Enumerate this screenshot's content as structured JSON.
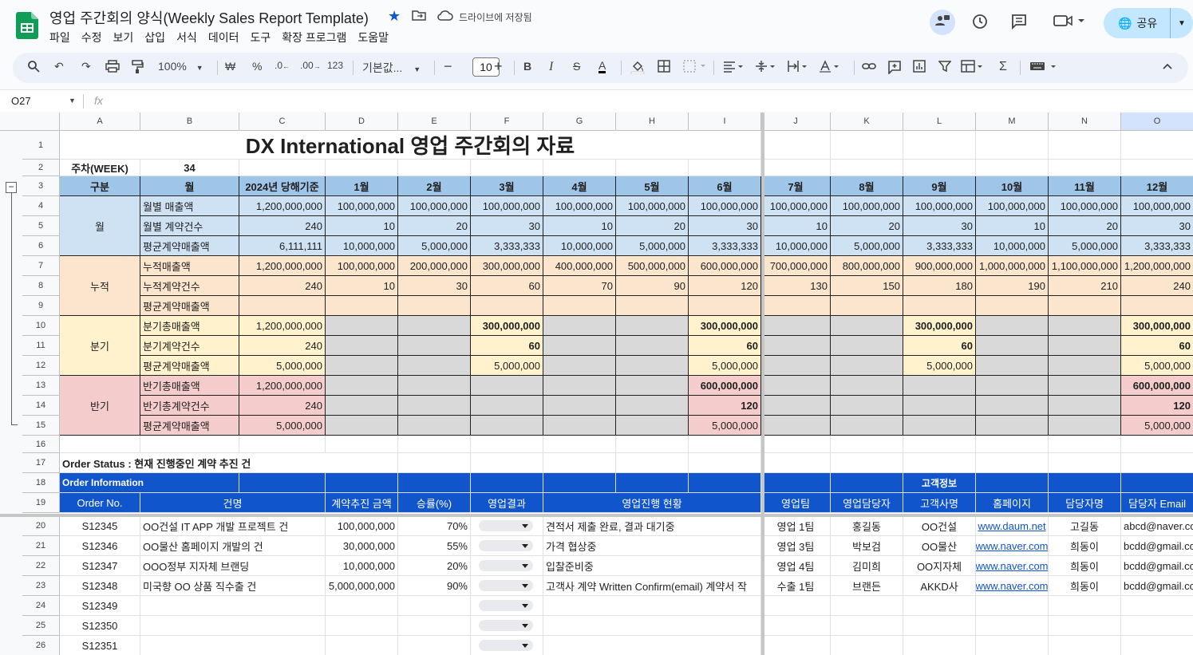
{
  "doc": {
    "title": "영업 주간회의 양식(Weekly Sales Report Template)",
    "saved": "드라이브에 저장됨",
    "share": "공유"
  },
  "menu": [
    "파일",
    "수정",
    "보기",
    "삽입",
    "서식",
    "데이터",
    "도구",
    "확장 프로그램",
    "도움말"
  ],
  "toolbar": {
    "zoom": "100%",
    "currency": "₩",
    "percent": "%",
    "dec_less": ".0",
    "dec_more": ".00",
    "num_fmt": "123",
    "font": "기본값...",
    "font_size": "10"
  },
  "formula": {
    "cell_ref": "O27",
    "fx": "fx"
  },
  "columns": [
    "A",
    "B",
    "C",
    "D",
    "E",
    "F",
    "G",
    "H",
    "I",
    "J",
    "K",
    "L",
    "M",
    "N",
    "O"
  ],
  "rows": [
    "1",
    "2",
    "3",
    "4",
    "5",
    "6",
    "7",
    "8",
    "9",
    "10",
    "11",
    "12",
    "13",
    "14",
    "15",
    "16",
    "17",
    "18",
    "19",
    "20",
    "21",
    "22",
    "23",
    "24",
    "25",
    "26"
  ],
  "sheet": {
    "title": "DX International 영업 주간회의 자료",
    "week_label": "주차(WEEK)",
    "week_value": "34",
    "header": {
      "group": "구분",
      "sub": "월",
      "total": "2024년 당해기준",
      "months": [
        "1월",
        "2월",
        "3월",
        "4월",
        "5월",
        "6월",
        "7월",
        "8월",
        "9월",
        "10월",
        "11월",
        "12월"
      ]
    },
    "groups": [
      "월",
      "누적",
      "분기",
      "반기"
    ],
    "labels": [
      "월별 매출액",
      "월별 계약건수",
      "평균계약매출액",
      "누적매출액",
      "누적계약건수",
      "평균계약매출액",
      "분기총매출액",
      "분기계약건수",
      "평균계약매출액",
      "반기총매출액",
      "반기총계약건수",
      "평균계약매출액"
    ],
    "totals": [
      "1,200,000,000",
      "240",
      "6,111,111",
      "1,200,000,000",
      "240",
      "",
      "1,200,000,000",
      "240",
      "5,000,000",
      "1,200,000,000",
      "240",
      "5,000,000"
    ],
    "monthly_sales": [
      "100,000,000",
      "100,000,000",
      "100,000,000",
      "100,000,000",
      "100,000,000",
      "100,000,000",
      "100,000,000",
      "100,000,000",
      "100,000,000",
      "100,000,000",
      "100,000,000",
      "100,000,000"
    ],
    "monthly_count": [
      "10",
      "20",
      "30",
      "10",
      "20",
      "30",
      "10",
      "20",
      "30",
      "10",
      "20",
      "30"
    ],
    "monthly_avg": [
      "10,000,000",
      "5,000,000",
      "3,333,333",
      "10,000,000",
      "5,000,000",
      "3,333,333",
      "10,000,000",
      "5,000,000",
      "3,333,333",
      "10,000,000",
      "5,000,000",
      "3,333,333"
    ],
    "cum_sales": [
      "100,000,000",
      "200,000,000",
      "300,000,000",
      "400,000,000",
      "500,000,000",
      "600,000,000",
      "700,000,000",
      "800,000,000",
      "900,000,000",
      "1,000,000,000",
      "1,100,000,000",
      "1,200,000,000"
    ],
    "cum_count": [
      "10",
      "30",
      "60",
      "70",
      "90",
      "120",
      "130",
      "150",
      "180",
      "190",
      "210",
      "240"
    ],
    "quarter": {
      "sales": "300,000,000",
      "count": "60",
      "avg": "5,000,000"
    },
    "half": {
      "sales": "600,000,000",
      "count": "120",
      "avg": "5,000,000"
    },
    "order_status": "Order Status : 현재 진행중인 계약 추진 건",
    "order_info": "Order Information",
    "customer_info": "고객정보",
    "order_headers": [
      "Order No.",
      "건명",
      "계약추진 금액",
      "승률(%)",
      "영업결과",
      "영업진행 현황",
      "영업팀",
      "영업담당자",
      "고객사명",
      "홈페이지",
      "담당자명",
      "담당자 Email"
    ],
    "orders": [
      {
        "no": "S12345",
        "name": "OO건설 IT APP 개발 프로젝트 건",
        "amount": "100,000,000",
        "rate": "70%",
        "status": "견적서 제출 완료, 결과 대기중",
        "team": "영업 1팀",
        "rep": "홍길동",
        "client": "OO건설",
        "home": "www.daum.net",
        "contact": "고길동",
        "email": "abcd@naver.com"
      },
      {
        "no": "S12346",
        "name": "OO물산 홈페이지 개발의 건",
        "amount": "30,000,000",
        "rate": "55%",
        "status": "가격 협상중",
        "team": "영업 3팀",
        "rep": "박보검",
        "client": "OO물산",
        "home": "www.naver.com",
        "contact": "희동이",
        "email": "bcdd@gmail.com"
      },
      {
        "no": "S12347",
        "name": "OOO정부 지자체 브랜딩",
        "amount": "10,000,000",
        "rate": "20%",
        "status": "입찰준비중",
        "team": "영업 4팀",
        "rep": "김미희",
        "client": "OO지자체",
        "home": "www.naver.com",
        "contact": "희동이",
        "email": "bcdd@gmail.com"
      },
      {
        "no": "S12348",
        "name": "미국향 OO 상품 직수출 건",
        "amount": "5,000,000,000",
        "rate": "90%",
        "status": "고객사 계약 Written Confirm(email) 계약서 작",
        "team": "수출 1팀",
        "rep": "브랜든",
        "client": "AKKD사",
        "home": "www.naver.com",
        "contact": "희동이",
        "email": "bcdd@gmail.com"
      },
      {
        "no": "S12349"
      },
      {
        "no": "S12350"
      },
      {
        "no": "S12351"
      }
    ]
  },
  "colors": {
    "accent": "#0b57d0",
    "header_blue": "#9fc5e8",
    "month_fill": "#cfe2f3",
    "cum_fill": "#fce5cd",
    "quarter_fill": "#fff2cc",
    "half_fill": "#f4cccc",
    "gray": "#d9d9d9",
    "order_blue": "#1155cc"
  }
}
